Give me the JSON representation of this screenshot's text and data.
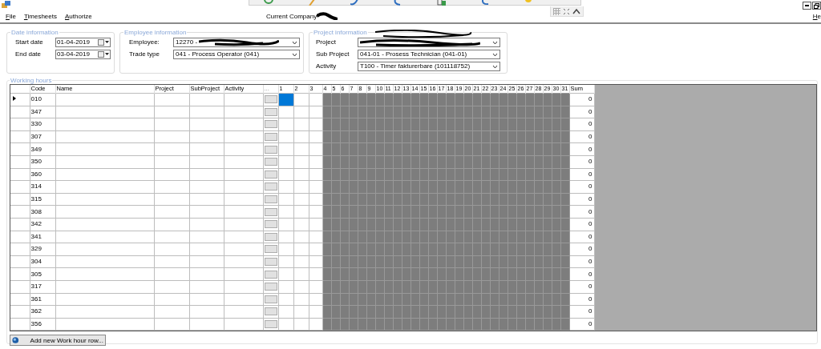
{
  "menu": [
    {
      "label": "File"
    },
    {
      "label": "Timesheets"
    },
    {
      "label": "Authorize"
    }
  ],
  "help_menu": "He",
  "company_label": "Current Company",
  "date_information": {
    "title": "Date information",
    "fields": [
      {
        "label": "Start date",
        "value": "01-04-2019"
      },
      {
        "label": "End date",
        "value": "03-04-2019"
      }
    ]
  },
  "employee_information": {
    "title": "Employee information",
    "fields": [
      {
        "label": "Employee:",
        "value": "12270 -",
        "redacted": true
      },
      {
        "label": "Trade type",
        "value": "041 - Process Operator (041)",
        "redacted": false
      }
    ]
  },
  "project_information": {
    "title": "Project information",
    "title_redacted": true,
    "fields": [
      {
        "label": "Project",
        "redacted": true
      },
      {
        "label": "Sub Project",
        "value": "041-01 - Prosess Technician (041-01)",
        "redacted": false
      },
      {
        "label": "Activity",
        "value": "T100 - Timer fakturerbare (101118752)",
        "redacted": false
      }
    ]
  },
  "working_hours": {
    "title": "Working hours",
    "columns": [
      "Code",
      "Name",
      "Project",
      "SubProject",
      "Activity",
      "..."
    ],
    "days": [
      {
        "label": "1",
        "disabled": false,
        "selected": true
      },
      {
        "label": "2",
        "disabled": false,
        "selected": false
      },
      {
        "label": "3",
        "disabled": false,
        "selected": false
      },
      {
        "label": "4",
        "disabled": true,
        "selected": false
      },
      {
        "label": "5",
        "disabled": true,
        "selected": false
      },
      {
        "label": "6",
        "disabled": true,
        "selected": false
      },
      {
        "label": "7",
        "disabled": true,
        "selected": false
      },
      {
        "label": "8",
        "disabled": true,
        "selected": false
      },
      {
        "label": "9",
        "disabled": true,
        "selected": false
      },
      {
        "label": "10",
        "disabled": true,
        "selected": false
      },
      {
        "label": "11",
        "disabled": true,
        "selected": false
      },
      {
        "label": "12",
        "disabled": true,
        "selected": false
      },
      {
        "label": "13",
        "disabled": true,
        "selected": false
      },
      {
        "label": "14",
        "disabled": true,
        "selected": false
      },
      {
        "label": "15",
        "disabled": true,
        "selected": false
      },
      {
        "label": "16",
        "disabled": true,
        "selected": false
      },
      {
        "label": "17",
        "disabled": true,
        "selected": false
      },
      {
        "label": "18",
        "disabled": true,
        "selected": false
      },
      {
        "label": "19",
        "disabled": true,
        "selected": false
      },
      {
        "label": "20",
        "disabled": true,
        "selected": false
      },
      {
        "label": "21",
        "disabled": true,
        "selected": false
      },
      {
        "label": "22",
        "disabled": true,
        "selected": false
      },
      {
        "label": "23",
        "disabled": true,
        "selected": false
      },
      {
        "label": "24",
        "disabled": true,
        "selected": false
      },
      {
        "label": "25",
        "disabled": true,
        "selected": false
      },
      {
        "label": "26",
        "disabled": true,
        "selected": false
      },
      {
        "label": "27",
        "disabled": true,
        "selected": false
      },
      {
        "label": "28",
        "disabled": true,
        "selected": false
      },
      {
        "label": "29",
        "disabled": true,
        "selected": false
      },
      {
        "label": "30",
        "disabled": true,
        "selected": false
      },
      {
        "label": "31",
        "disabled": true,
        "selected": false
      }
    ],
    "sum_column": "Sum",
    "rows": [
      {
        "code": "010",
        "sum": "0",
        "selected": true
      },
      {
        "code": "347",
        "sum": "0",
        "selected": false
      },
      {
        "code": "330",
        "sum": "0",
        "selected": false
      },
      {
        "code": "307",
        "sum": "0",
        "selected": false
      },
      {
        "code": "349",
        "sum": "0",
        "selected": false
      },
      {
        "code": "350",
        "sum": "0",
        "selected": false
      },
      {
        "code": "360",
        "sum": "0",
        "selected": false
      },
      {
        "code": "314",
        "sum": "0",
        "selected": false
      },
      {
        "code": "315",
        "sum": "0",
        "selected": false
      },
      {
        "code": "308",
        "sum": "0",
        "selected": false
      },
      {
        "code": "342",
        "sum": "0",
        "selected": false
      },
      {
        "code": "341",
        "sum": "0",
        "selected": false
      },
      {
        "code": "329",
        "sum": "0",
        "selected": false
      },
      {
        "code": "304",
        "sum": "0",
        "selected": false
      },
      {
        "code": "305",
        "sum": "0",
        "selected": false
      },
      {
        "code": "317",
        "sum": "0",
        "selected": false
      },
      {
        "code": "361",
        "sum": "0",
        "selected": false
      },
      {
        "code": "362",
        "sum": "0",
        "selected": false
      },
      {
        "code": "356",
        "sum": "0",
        "selected": false
      }
    ]
  },
  "add_button": "Add new Work hour row..."
}
